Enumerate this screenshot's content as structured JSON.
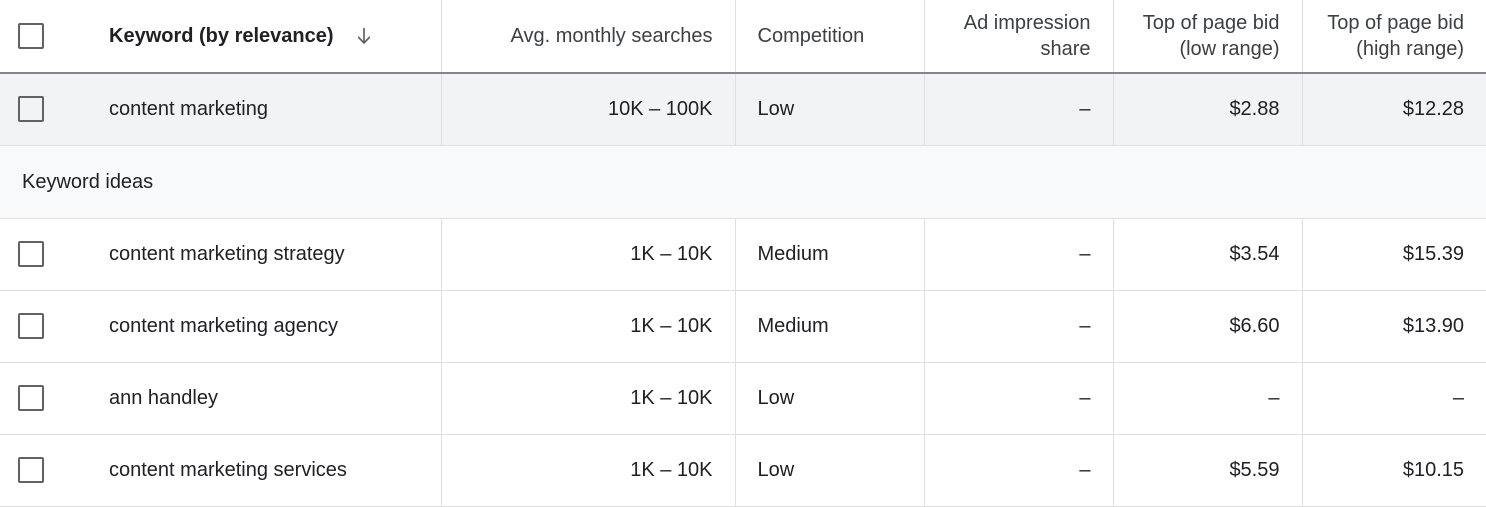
{
  "table": {
    "columns": [
      {
        "key": "keyword",
        "label": "Keyword (by relevance)",
        "align": "left",
        "sort_icon": "arrow-down-icon"
      },
      {
        "key": "searches",
        "label": "Avg. monthly searches",
        "align": "right"
      },
      {
        "key": "competition",
        "label": "Competition",
        "align": "left"
      },
      {
        "key": "impression_share",
        "label_line1": "Ad impression",
        "label_line2": "share",
        "align": "right"
      },
      {
        "key": "bid_low",
        "label_line1": "Top of page bid",
        "label_line2": "(low range)",
        "align": "right"
      },
      {
        "key": "bid_high",
        "label_line1": "Top of page bid",
        "label_line2": "(high range)",
        "align": "right"
      }
    ],
    "select_all_checkbox": {
      "checked": false
    },
    "rows": [
      {
        "keyword": "content marketing",
        "searches": "10K – 100K",
        "competition": "Low",
        "impression_share": "–",
        "bid_low": "$2.88",
        "bid_high": "$12.28",
        "highlighted": true,
        "checked": false
      }
    ],
    "section": {
      "label": "Keyword ideas"
    },
    "idea_rows": [
      {
        "keyword": "content marketing strategy",
        "searches": "1K – 10K",
        "competition": "Medium",
        "impression_share": "–",
        "bid_low": "$3.54",
        "bid_high": "$15.39",
        "checked": false
      },
      {
        "keyword": "content marketing agency",
        "searches": "1K – 10K",
        "competition": "Medium",
        "impression_share": "–",
        "bid_low": "$6.60",
        "bid_high": "$13.90",
        "checked": false
      },
      {
        "keyword": "ann handley",
        "searches": "1K – 10K",
        "competition": "Low",
        "impression_share": "–",
        "bid_low": "–",
        "bid_high": "–",
        "checked": false
      },
      {
        "keyword": "content marketing services",
        "searches": "1K – 10K",
        "competition": "Low",
        "impression_share": "–",
        "bid_low": "$5.59",
        "bid_high": "$10.15",
        "checked": false
      }
    ]
  },
  "colors": {
    "row_highlight": "#f1f3f4",
    "section_band": "#f8f9fa",
    "grid_line": "#e0e0e0",
    "header_rule": "#80868b",
    "text_primary": "#202124",
    "text_secondary": "#3c4043",
    "checkbox_border": "#5f6368"
  }
}
